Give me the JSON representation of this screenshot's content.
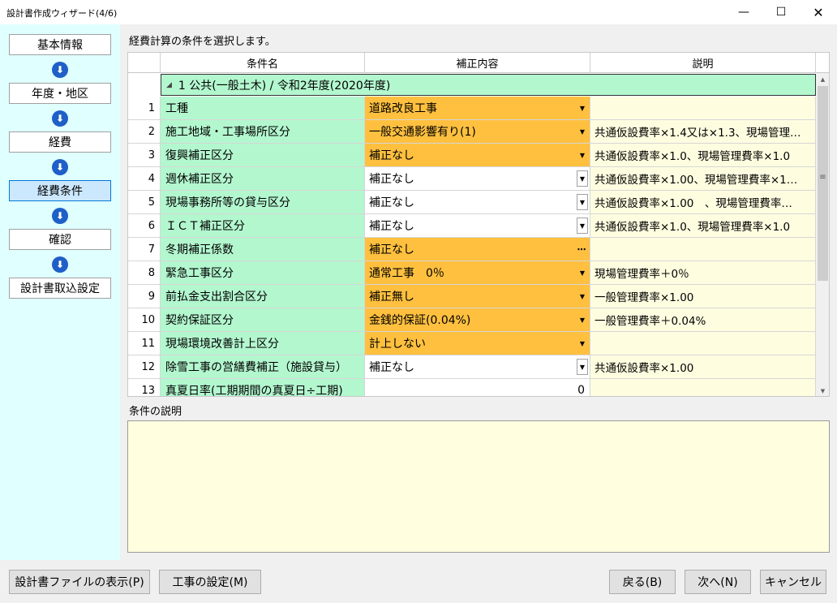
{
  "window": {
    "title": "設計書作成ウィザード(4/6)",
    "minimize": "—",
    "maximize": "☐",
    "close": "✕"
  },
  "steps": [
    "基本情報",
    "年度・地区",
    "経費",
    "経費条件",
    "確認",
    "設計書取込設定"
  ],
  "active_step": "経費条件",
  "instruction": "経費計算の条件を選択します。",
  "grid": {
    "headers": [
      "条件名",
      "補正内容",
      "説明"
    ],
    "group": "1 公共(一般土木) / 令和2年度(2020年度)",
    "rows": [
      {
        "num": "1",
        "name": "工種",
        "value": "道路改良工事",
        "desc": "",
        "style": "orange",
        "control": "dropdown"
      },
      {
        "num": "2",
        "name": "施工地域・工事場所区分",
        "value": "一般交通影響有り(1)",
        "desc": "共通仮設費率×1.4又は×1.3、現場管理…",
        "style": "orange",
        "control": "dropdown"
      },
      {
        "num": "3",
        "name": "復興補正区分",
        "value": "補正なし",
        "desc": "共通仮設費率×1.0、現場管理費率×1.0",
        "style": "orange",
        "control": "dropdown"
      },
      {
        "num": "4",
        "name": "週休補正区分",
        "value": "補正なし",
        "desc": "共通仮設費率×1.00、現場管理費率×1…",
        "style": "white",
        "control": "dropdown-boxed"
      },
      {
        "num": "5",
        "name": "現場事務所等の貸与区分",
        "value": "補正なし",
        "desc": "共通仮設費率×1.00　、現場管理費率…",
        "style": "white",
        "control": "dropdown-boxed"
      },
      {
        "num": "6",
        "name": "ＩＣＴ補正区分",
        "value": "補正なし",
        "desc": "共通仮設費率×1.0、現場管理費率×1.0",
        "style": "white",
        "control": "dropdown-boxed"
      },
      {
        "num": "7",
        "name": "冬期補正係数",
        "value": "補正なし",
        "desc": "",
        "style": "orange",
        "control": "ellipsis"
      },
      {
        "num": "8",
        "name": "緊急工事区分",
        "value": "通常工事　0％",
        "desc": "現場管理費率＋0％",
        "style": "orange",
        "control": "dropdown"
      },
      {
        "num": "9",
        "name": "前払金支出割合区分",
        "value": "補正無し",
        "desc": "一般管理費率×1.00",
        "style": "orange",
        "control": "dropdown"
      },
      {
        "num": "10",
        "name": "契約保証区分",
        "value": "金銭的保証(0.04%)",
        "desc": "一般管理費率＋0.04%",
        "style": "orange",
        "control": "dropdown"
      },
      {
        "num": "11",
        "name": "現場環境改善計上区分",
        "value": "計上しない",
        "desc": "",
        "style": "orange",
        "control": "dropdown"
      },
      {
        "num": "12",
        "name": "除雪工事の営繕費補正（施設貸与）",
        "value": "補正なし",
        "desc": "共通仮設費率×1.00",
        "style": "white",
        "control": "dropdown-boxed"
      },
      {
        "num": "13",
        "name": "真夏日率(工期期間の真夏日÷工期)",
        "value": "0",
        "desc": "",
        "style": "white-right",
        "control": "none"
      }
    ]
  },
  "description_label": "条件の説明",
  "description_text": "",
  "buttons": {
    "show_file": "設計書ファイルの表示(P)",
    "work_settings": "工事の設定(M)",
    "back": "戻る(B)",
    "next": "次へ(N)",
    "cancel": "キャンセル"
  },
  "colors": {
    "condition_name_bg": "#b3f7cf",
    "edited_value_bg": "#ffc03f",
    "description_bg": "#fffde0",
    "steps_panel_bg": "#e0ffff",
    "arrow_icon": "#1e5fc8"
  }
}
